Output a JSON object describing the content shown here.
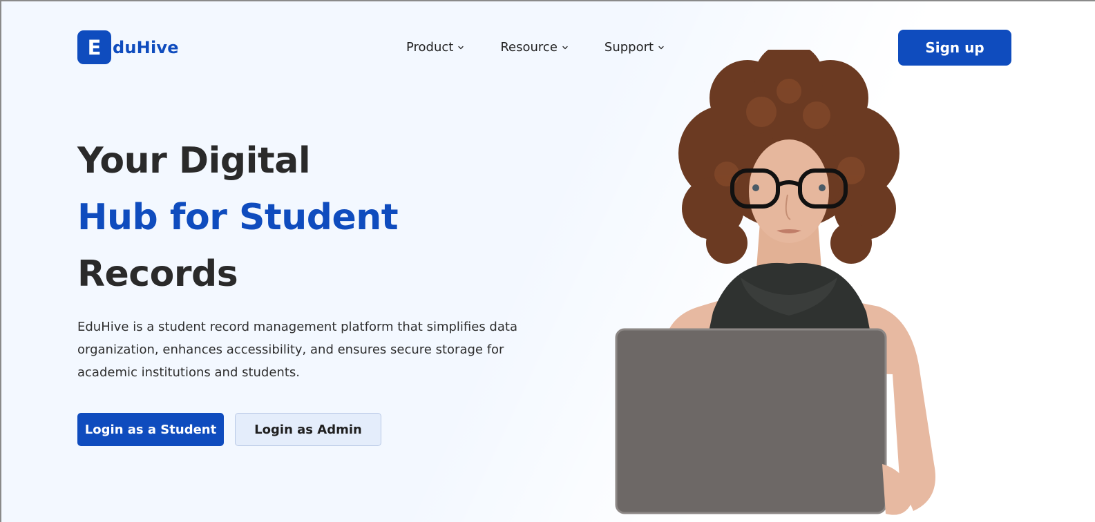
{
  "brand": {
    "mark": "E",
    "name": "duHive",
    "color": "#0f4cbe"
  },
  "nav": {
    "items": [
      {
        "label": "Product",
        "icon": "chevron-down-icon"
      },
      {
        "label": "Resource",
        "icon": "chevron-down-icon"
      },
      {
        "label": "Support",
        "icon": "chevron-down-icon"
      }
    ],
    "signup_label": "Sign up"
  },
  "hero": {
    "title_line1": "Your Digital",
    "title_line2": "Hub for Student",
    "title_line3": "Records",
    "description": "EduHive is a student record management platform that simplifies data organization, enhances accessibility, and ensures secure storage for academic institutions and students.",
    "login_student_label": "Login as a Student",
    "login_admin_label": "Login as Admin",
    "image": "woman-with-laptop-illustration"
  },
  "colors": {
    "accent": "#0f4cbe",
    "text_dark": "#2a2a2a",
    "background": "#f3f8ff",
    "secondary_button": "#e4edfb"
  }
}
